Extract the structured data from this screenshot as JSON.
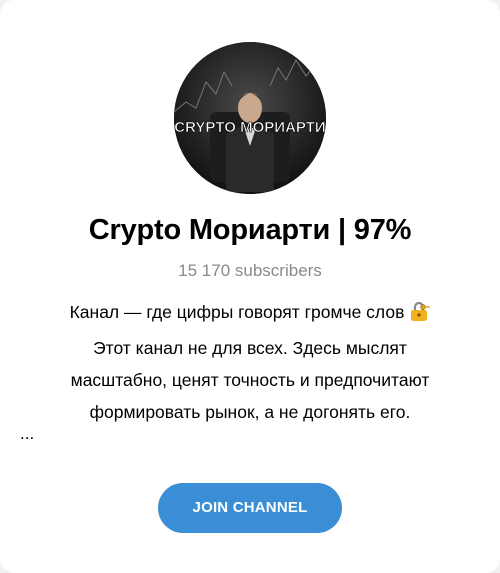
{
  "channel": {
    "title": "Crypto Мориарти | 97%",
    "subscribers": "15 170 subscribers",
    "avatar_text": "CRYPTO МОРИАРТИ",
    "description_lines": [
      "Канал — где цифры говорят громче слов",
      "Этот канал не для всех. Здесь мыслят",
      "масштабно, ценят точность и предпочитают",
      "формировать рынок, а не догонять его."
    ],
    "ellipsis": "...",
    "join_label": "JOIN CHANNEL",
    "emoji_icon": "lock-with-key-icon"
  },
  "colors": {
    "accent": "#3a8ed5",
    "subtle_text": "#8a8a8a",
    "background": "#ffffff"
  }
}
